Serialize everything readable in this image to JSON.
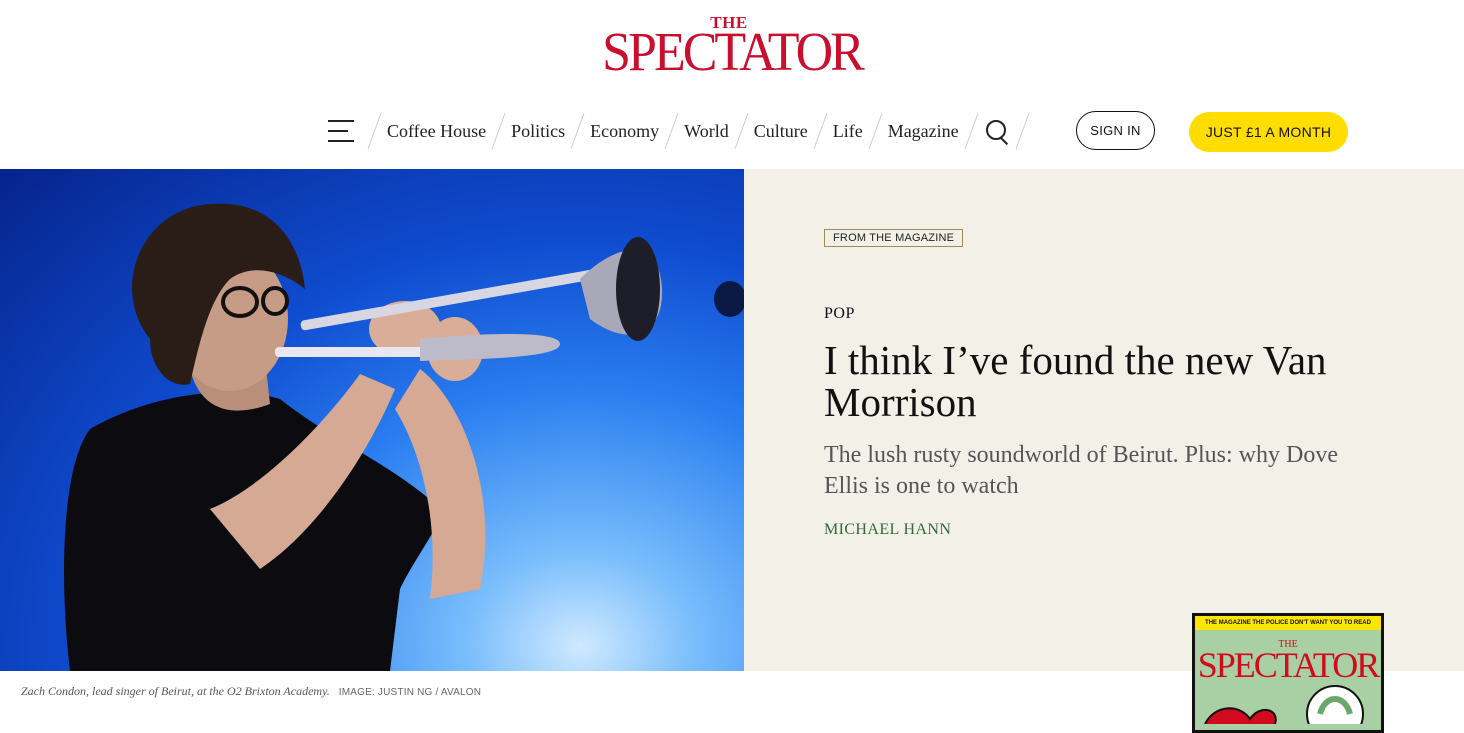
{
  "masthead": {
    "the": "THE",
    "name": "SPECTATOR"
  },
  "nav": {
    "items": [
      "Coffee House",
      "Politics",
      "Economy",
      "World",
      "Culture",
      "Life",
      "Magazine"
    ],
    "sign_in": "SIGN IN",
    "subscribe": "JUST £1 A MONTH"
  },
  "article": {
    "tag": "FROM THE MAGAZINE",
    "section": "POP",
    "headline": "I think I’ve found the new Van Morrison",
    "standfirst": "The lush rusty soundworld of Beirut. Plus: why Dove Ellis is one to watch",
    "author": "MICHAEL HANN"
  },
  "caption": {
    "description": "Zach Condon, lead singer of Beirut, at the O2 Brixton Academy.",
    "credit": "IMAGE: JUSTIN NG / AVALON"
  },
  "cover": {
    "strap": "THE MAGAZINE THE POLICE DON'T WANT YOU TO READ",
    "the": "THE",
    "title": "SPECTATOR"
  },
  "colors": {
    "brand_red": "#c8102e",
    "subscribe_yellow": "#ffdd00",
    "panel_bg": "#f3f0e8",
    "author_green": "#2e6b3c"
  }
}
